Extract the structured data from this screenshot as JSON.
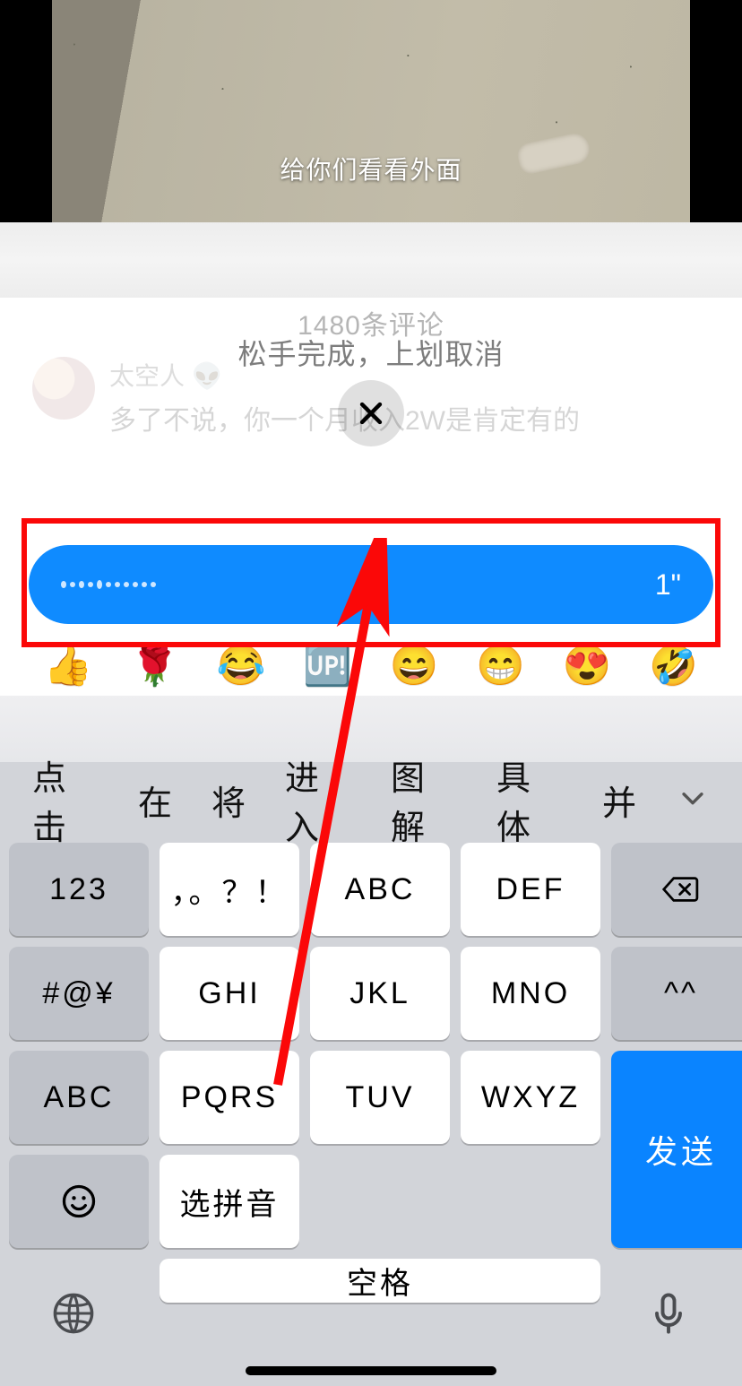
{
  "video": {
    "caption": "给你们看看外面"
  },
  "sheet": {
    "comment_count": "1480条评论",
    "release_hint": "松手完成，上划取消",
    "bg_comment": {
      "author": "太空人",
      "text": "多了不说，你一个月收入2W是肯定有的"
    }
  },
  "voice": {
    "duration": "1\""
  },
  "emoji_bar": [
    "👍",
    "🌹",
    "😂",
    "🆙",
    "😄",
    "😁",
    "😍",
    "🤣"
  ],
  "keyboard": {
    "suggestions": [
      "点击",
      "在",
      "将",
      "进入",
      "图解",
      "具体",
      "并"
    ],
    "keys": {
      "r1": [
        "123",
        "，。？！",
        "ABC",
        "DEF"
      ],
      "r2": [
        "#@¥",
        "GHI",
        "JKL",
        "MNO",
        "^^"
      ],
      "r3": [
        "ABC",
        "PQRS",
        "TUV",
        "WXYZ"
      ],
      "r4": [
        "选拼音",
        "空格"
      ],
      "send": "发送"
    }
  },
  "annotation": {
    "highlight_color": "#fb0808",
    "arrow_color": "#fb0808"
  }
}
